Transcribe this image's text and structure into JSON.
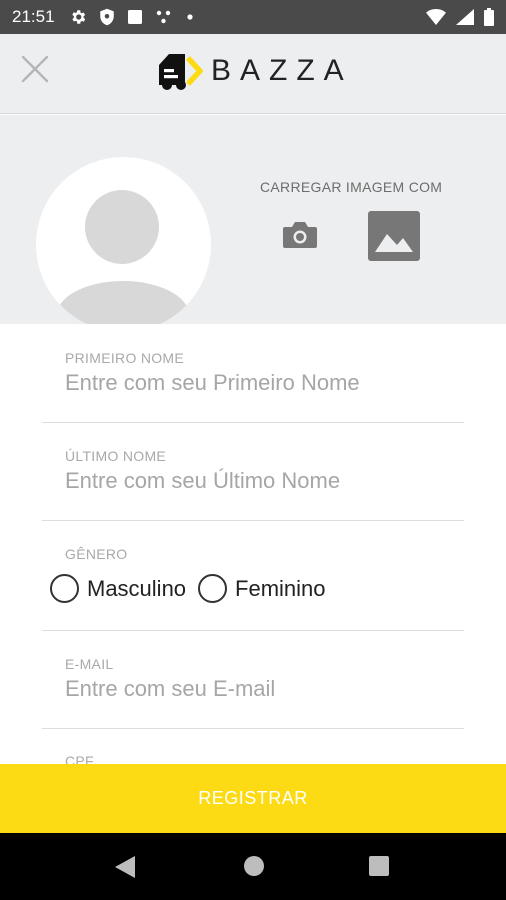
{
  "statusbar": {
    "time": "21:51",
    "icons": [
      "gear-icon",
      "shield-icon",
      "square-icon",
      "dots-icon",
      "dot-icon"
    ],
    "right_icons": [
      "wifi-icon",
      "signal-icon",
      "battery-icon"
    ]
  },
  "header": {
    "close_icon": "close-icon",
    "logo_text": "BAZZA",
    "brand_color": "#fcdb14"
  },
  "photo": {
    "upload_label": "CARREGAR IMAGEM COM",
    "camera_icon": "camera-icon",
    "gallery_icon": "image-icon"
  },
  "form": {
    "first_name": {
      "label": "PRIMEIRO NOME",
      "placeholder": "Entre com seu Primeiro Nome",
      "value": ""
    },
    "last_name": {
      "label": "ÚLTIMO NOME",
      "placeholder": "Entre com seu Último Nome",
      "value": ""
    },
    "gender": {
      "label": "GÊNERO",
      "options": [
        "Masculino",
        "Feminino"
      ],
      "selected": null
    },
    "email": {
      "label": "E-MAIL",
      "placeholder": "Entre com seu E-mail",
      "value": ""
    },
    "cpf": {
      "label": "CPF"
    }
  },
  "register": {
    "label": "REGISTRAR"
  },
  "navbar": {
    "icons": [
      "back-icon",
      "home-icon",
      "recents-icon"
    ]
  }
}
